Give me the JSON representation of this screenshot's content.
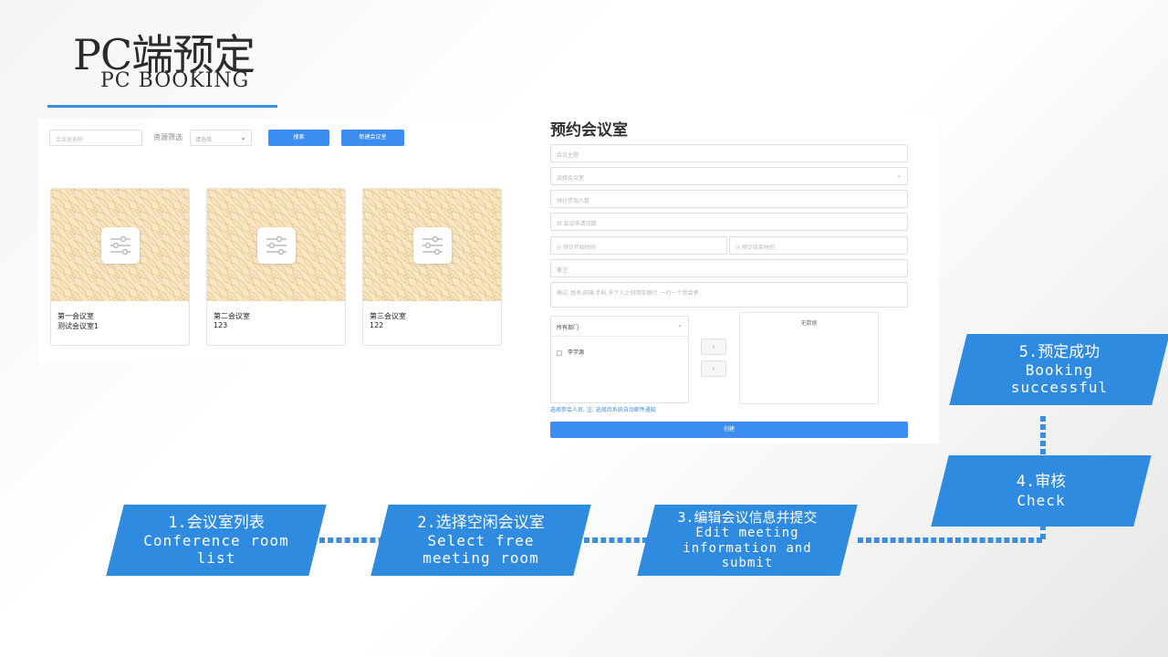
{
  "header": {
    "title_cn": "PC端预定",
    "title_en": "PC BOOKING"
  },
  "list_panel": {
    "search_placeholder": "会议室名称",
    "filter_label": "资源筛选",
    "filter_placeholder": "请选择",
    "search_button": "搜索",
    "new_button": "新建会议室",
    "cards": [
      {
        "name": "第一会议室",
        "desc": "测试会议室1"
      },
      {
        "name": "第二会议室",
        "desc": "123"
      },
      {
        "name": "第三会议室",
        "desc": "122"
      }
    ]
  },
  "form_panel": {
    "title": "预约会议室",
    "fields": {
      "topic": "会议主题",
      "room": "选择会议室",
      "attendees_count": "预计参加人数",
      "date": "会议申请日期",
      "start_time": "预计开始时间",
      "end_time": "预计结束时间",
      "remark": "备注",
      "participants": "格式: 姓名,邮箱,手机 多个人之间回车换行, 一行一个参会者"
    },
    "department_select": "所有部门",
    "person": "李学源",
    "no_data": "无数据",
    "hint": "选择参会人员, 注: 选择后系统自动邮件通知",
    "create_button": "创建"
  },
  "steps": [
    {
      "cn": "1.会议室列表",
      "en": "Conference room\nlist"
    },
    {
      "cn": "2.选择空闲会议室",
      "en": "Select free\nmeeting room"
    },
    {
      "cn": "3.编辑会议信息并提交",
      "en": "Edit meeting\ninformation and\nsubmit"
    },
    {
      "cn": "4.审核",
      "en": "Check"
    },
    {
      "cn": "5.预定成功",
      "en": "Booking\nsuccessful"
    }
  ],
  "colors": {
    "accent": "#2e8be0",
    "button": "#3b8ef0"
  }
}
